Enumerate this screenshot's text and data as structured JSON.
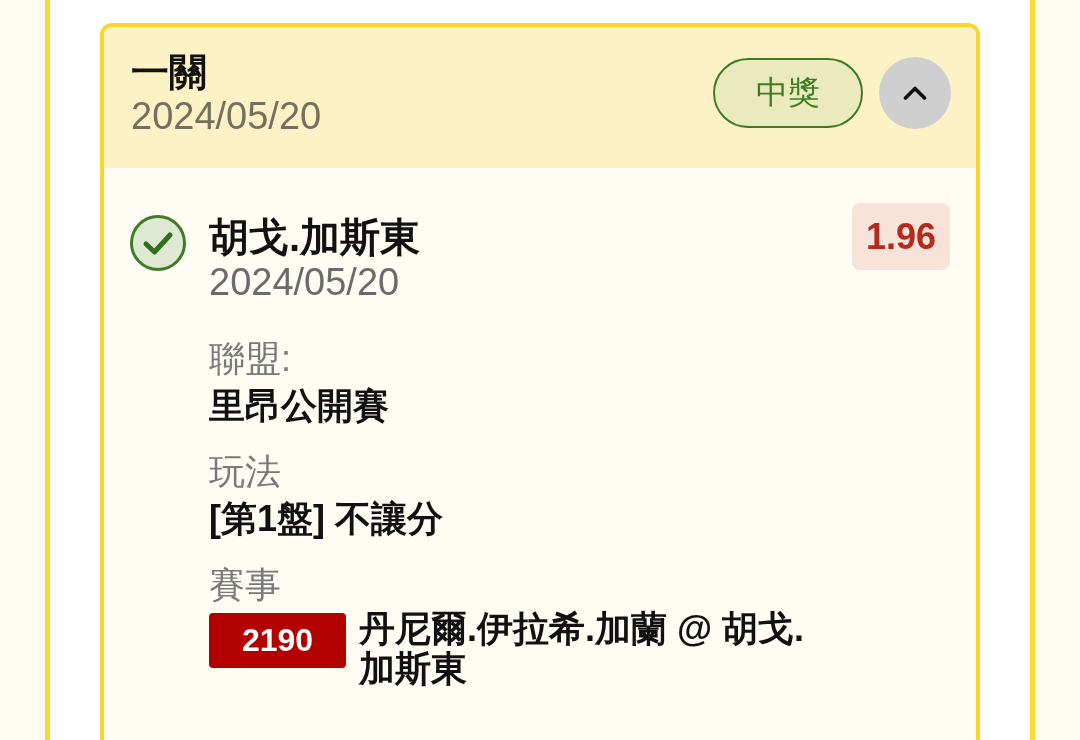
{
  "bet": {
    "title": "一關",
    "date": "2024/05/20",
    "status": {
      "label": "中獎",
      "kind": "won"
    },
    "expanded": true,
    "selections": [
      {
        "won": true,
        "name": "胡戈.加斯東",
        "date": "2024/05/20",
        "odds": "1.96",
        "fields": [
          {
            "label": "聯盟:",
            "value": "里昂公開賽"
          },
          {
            "label": "玩法",
            "value": "[第1盤] 不讓分"
          }
        ],
        "event": {
          "label": "賽事",
          "number": "2190",
          "matchup": "丹尼爾.伊拉希.加蘭 @ 胡戈.加斯東"
        }
      }
    ]
  }
}
